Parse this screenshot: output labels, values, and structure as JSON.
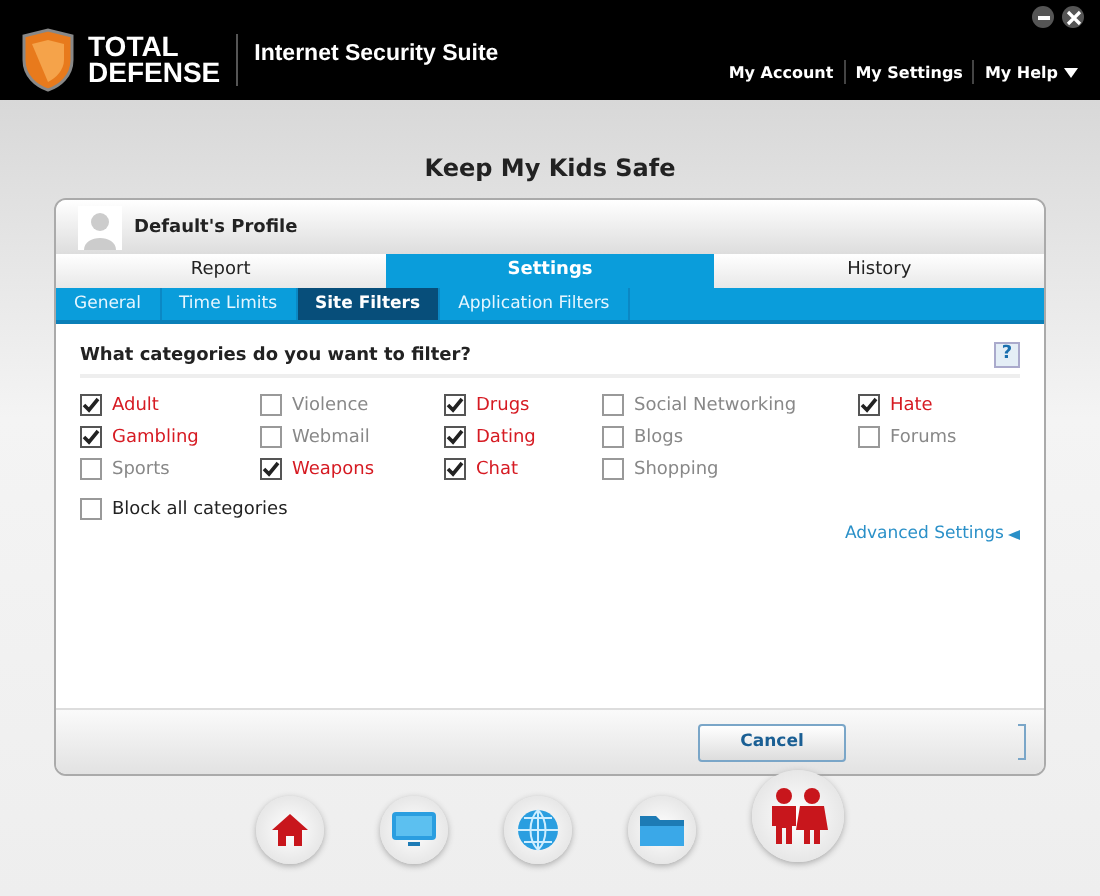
{
  "app": {
    "brand_line1": "TOTAL",
    "brand_line2": "DEFENSE",
    "product": "Internet Security Suite"
  },
  "top_links": [
    {
      "label": "My Account",
      "dropdown": false
    },
    {
      "label": "My Settings",
      "dropdown": false
    },
    {
      "label": "My Help",
      "dropdown": true
    }
  ],
  "page_title": "Keep My Kids Safe",
  "profile": {
    "name": "Default's Profile"
  },
  "tabs": [
    {
      "label": "Report",
      "selected": false
    },
    {
      "label": "Settings",
      "selected": true
    },
    {
      "label": "History",
      "selected": false
    }
  ],
  "subtabs": [
    {
      "label": "General",
      "selected": false
    },
    {
      "label": "Time Limits",
      "selected": false
    },
    {
      "label": "Site Filters",
      "selected": true
    },
    {
      "label": "Application Filters",
      "selected": false
    }
  ],
  "question": "What categories do you want to filter?",
  "help": "?",
  "categories": [
    {
      "label": "Adult",
      "checked": true
    },
    {
      "label": "Violence",
      "checked": false
    },
    {
      "label": "Drugs",
      "checked": true
    },
    {
      "label": "Social Networking",
      "checked": false
    },
    {
      "label": "Hate",
      "checked": true
    },
    {
      "label": "Gambling",
      "checked": true
    },
    {
      "label": "Webmail",
      "checked": false
    },
    {
      "label": "Dating",
      "checked": true
    },
    {
      "label": "Blogs",
      "checked": false
    },
    {
      "label": "Forums",
      "checked": false
    },
    {
      "label": "Sports",
      "checked": false
    },
    {
      "label": "Weapons",
      "checked": true
    },
    {
      "label": "Chat",
      "checked": true
    },
    {
      "label": "Shopping",
      "checked": false
    }
  ],
  "block_all": {
    "label": "Block all categories",
    "checked": false
  },
  "advanced_link": "Advanced Settings",
  "buttons": [
    "Cancel"
  ],
  "dock": [
    {
      "kind": "home",
      "selected": false
    },
    {
      "kind": "monitor",
      "selected": false
    },
    {
      "kind": "globe",
      "selected": false
    },
    {
      "kind": "folder",
      "selected": false
    },
    {
      "kind": "family",
      "selected": true
    }
  ]
}
